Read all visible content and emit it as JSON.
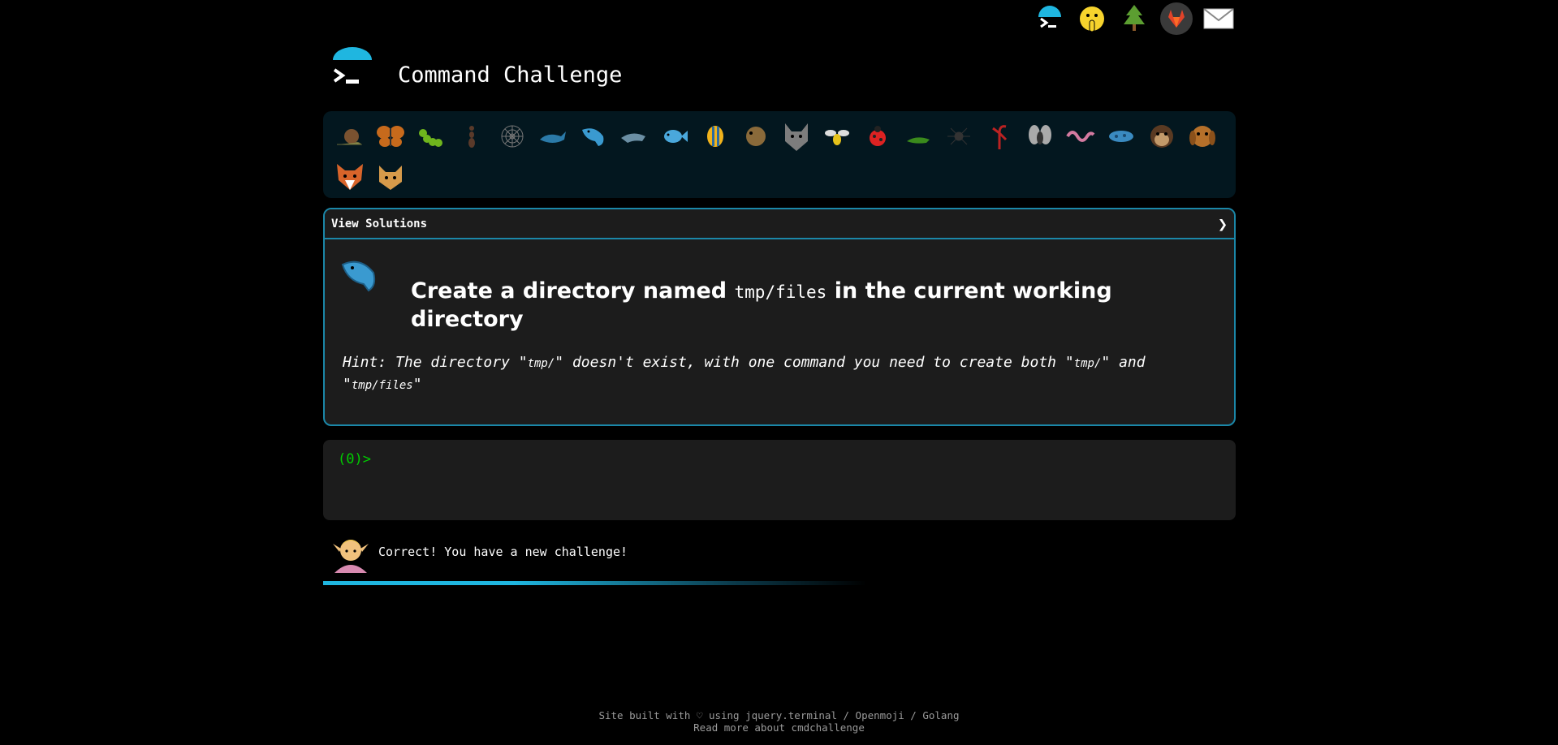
{
  "site": {
    "title": "Command Challenge"
  },
  "top_icons": [
    {
      "name": "terminal-icon"
    },
    {
      "name": "shush-face-icon"
    },
    {
      "name": "evergreen-tree-icon"
    },
    {
      "name": "gitlab-icon"
    },
    {
      "name": "envelope-icon"
    }
  ],
  "animals": [
    {
      "name": "snail-icon"
    },
    {
      "name": "butterfly-icon"
    },
    {
      "name": "caterpillar-icon"
    },
    {
      "name": "ant-icon"
    },
    {
      "name": "web-icon"
    },
    {
      "name": "whale-icon"
    },
    {
      "name": "spouting-whale-icon"
    },
    {
      "name": "dolphin-icon"
    },
    {
      "name": "fish-icon"
    },
    {
      "name": "tropical-fish-icon"
    },
    {
      "name": "blowfish-icon"
    },
    {
      "name": "wolf-icon"
    },
    {
      "name": "bee-icon"
    },
    {
      "name": "ladybug-icon"
    },
    {
      "name": "cricket-icon"
    },
    {
      "name": "spider-icon"
    },
    {
      "name": "scorpion-icon"
    },
    {
      "name": "fly-icon"
    },
    {
      "name": "worm-icon"
    },
    {
      "name": "microbe-icon"
    },
    {
      "name": "monkey-icon"
    },
    {
      "name": "dog-icon"
    },
    {
      "name": "fox-icon"
    },
    {
      "name": "cat-icon"
    }
  ],
  "panel": {
    "toggle_label": "View Solutions",
    "toggle_chevron": "❯",
    "title_prefix": "Create a directory named",
    "title_code": "tmp/files",
    "title_suffix": "in the current working directory",
    "hint_prefix": "Hint: The directory \"",
    "hint_code1": "tmp/",
    "hint_middle": "\" doesn't exist, with one command you need to create both \"",
    "hint_code2": "tmp/",
    "hint_and": "\" and \"",
    "hint_code3": "tmp/files",
    "hint_end": "\""
  },
  "terminal": {
    "prompt": "(0)>"
  },
  "feedback": {
    "message": "Correct! You have a new challenge!"
  },
  "footer": {
    "line1": "Site built with ♡ using jquery.terminal / Openmoji / Golang",
    "line2": "Read more about cmdchallenge"
  },
  "colors": {
    "accent": "#1fb6e0",
    "panel_border": "#1b87a8",
    "prompt": "#00cc00"
  }
}
